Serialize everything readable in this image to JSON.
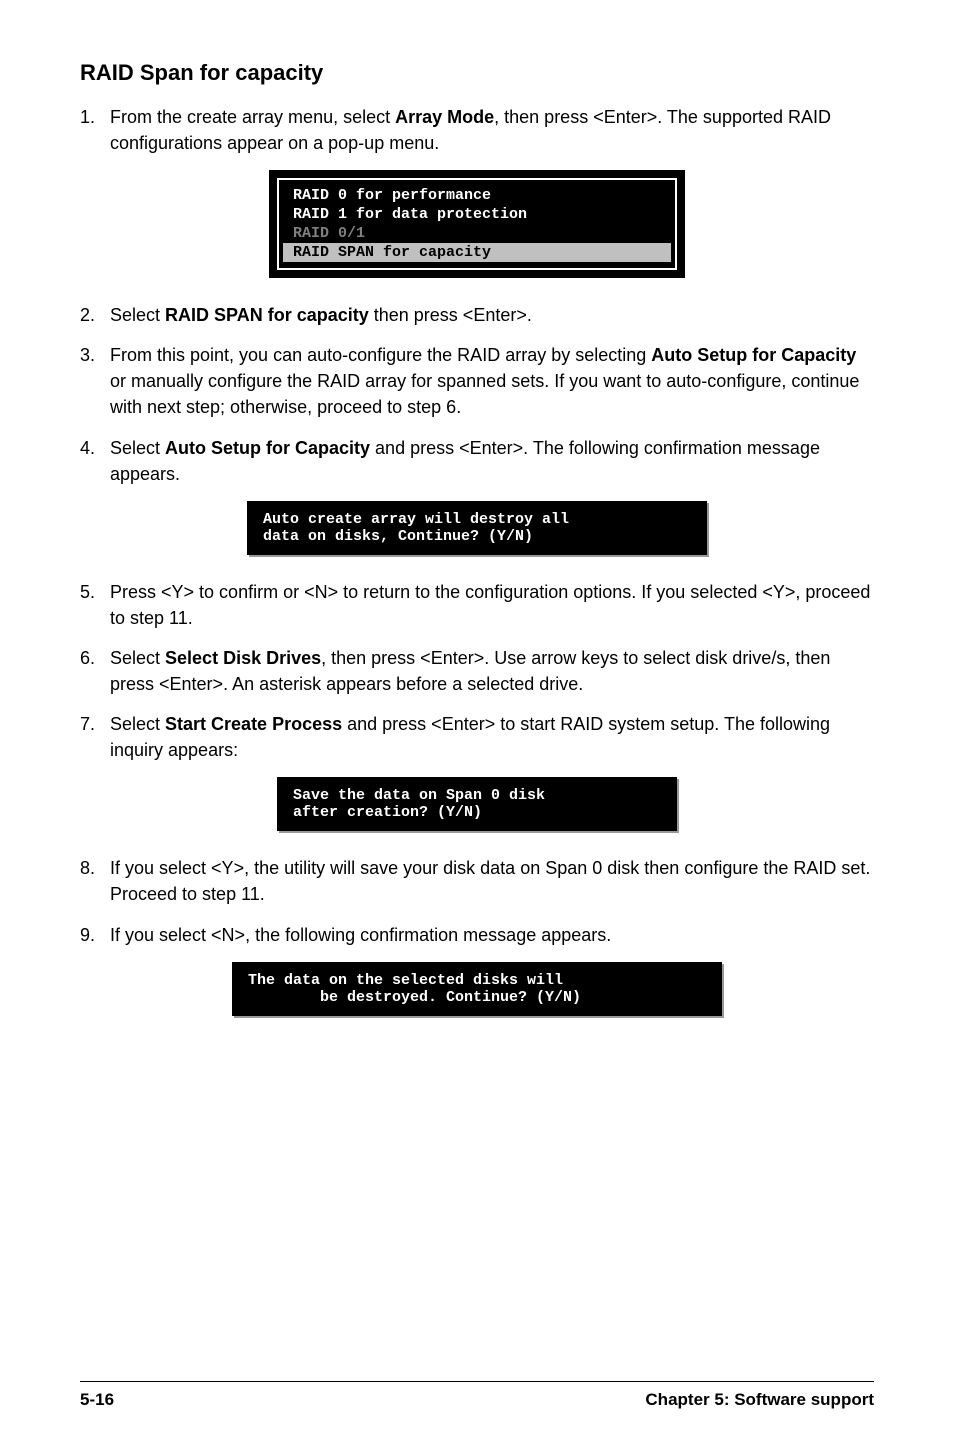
{
  "heading": "RAID Span for capacity",
  "steps": {
    "s1": {
      "num": "1.",
      "pre": "From the create array menu, select ",
      "bold": "Array Mode",
      "post": ", then press <Enter>. The supported RAID configurations appear on a pop-up menu."
    },
    "s2": {
      "num": "2.",
      "pre": "Select ",
      "bold": "RAID SPAN for capacity",
      "post": " then press <Enter>."
    },
    "s3": {
      "num": "3.",
      "pre": "From this point, you can auto-configure the RAID array by selecting ",
      "bold": "Auto Setup for Capacity",
      "post": " or manually configure the RAID array for spanned sets. If you want to auto-configure, continue with next step; otherwise, proceed to step 6."
    },
    "s4": {
      "num": "4.",
      "pre": "Select  ",
      "bold": "Auto Setup for Capacity",
      "post": " and press <Enter>. The following confirmation message appears."
    },
    "s5": {
      "num": "5.",
      "text": "Press <Y> to confirm or <N> to return to the configuration options. If you selected <Y>, proceed to step 11."
    },
    "s6": {
      "num": "6.",
      "pre": "Select ",
      "bold": "Select Disk Drives",
      "post": ", then press <Enter>. Use arrow keys to select disk drive/s, then press <Enter>. An asterisk appears before a selected drive."
    },
    "s7": {
      "num": "7.",
      "pre": "Select ",
      "bold": "Start Create Process",
      "post": " and press <Enter> to start RAID system setup. The following inquiry appears:"
    },
    "s8": {
      "num": "8.",
      "text": "If you select <Y>, the utility will save your disk data on Span 0 disk then configure the RAID set. Proceed to step 11."
    },
    "s9": {
      "num": "9.",
      "text": "If you select <N>, the following confirmation message appears."
    }
  },
  "menu": {
    "line1": "RAID 0 for performance",
    "line2": "RAID 1 for data protection",
    "line3": "RAID 0/1",
    "line4": "RAID SPAN for capacity"
  },
  "msg1": {
    "l1": "Auto create array will destroy all",
    "l2": "data on disks, Continue? (Y/N)"
  },
  "msg2": {
    "l1": "Save the data on Span 0 disk",
    "l2": "after creation? (Y/N)"
  },
  "msg3": {
    "l1": "The data on the selected disks will",
    "l2": "        be destroyed. Continue? (Y/N)"
  },
  "footer": {
    "page": "5-16",
    "chapter": "Chapter 5: Software support"
  }
}
